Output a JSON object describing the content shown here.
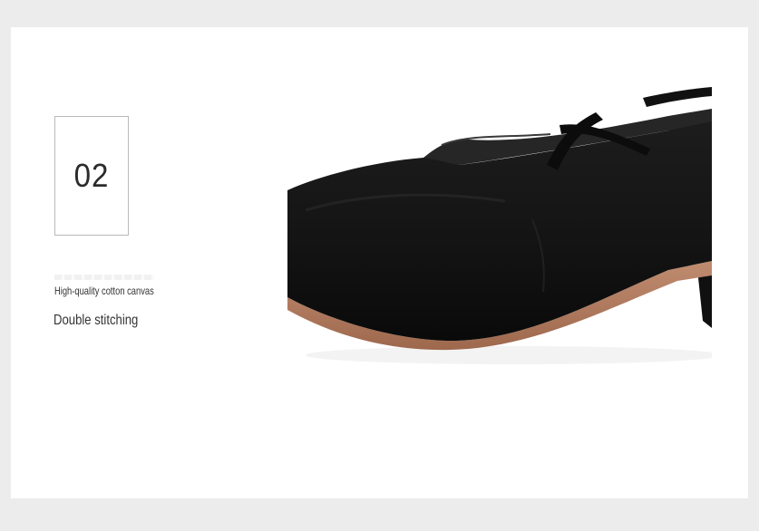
{
  "section": {
    "number": "02",
    "features": [
      "High-quality cotton canvas",
      "Double stitching"
    ]
  },
  "image": {
    "subject": "black canvas ballet slipper",
    "icon": "shoe-photo"
  },
  "colors": {
    "page_background": "#ececec",
    "card": "#ffffff",
    "shoe": "#151515",
    "sole": "#b27a5e"
  }
}
